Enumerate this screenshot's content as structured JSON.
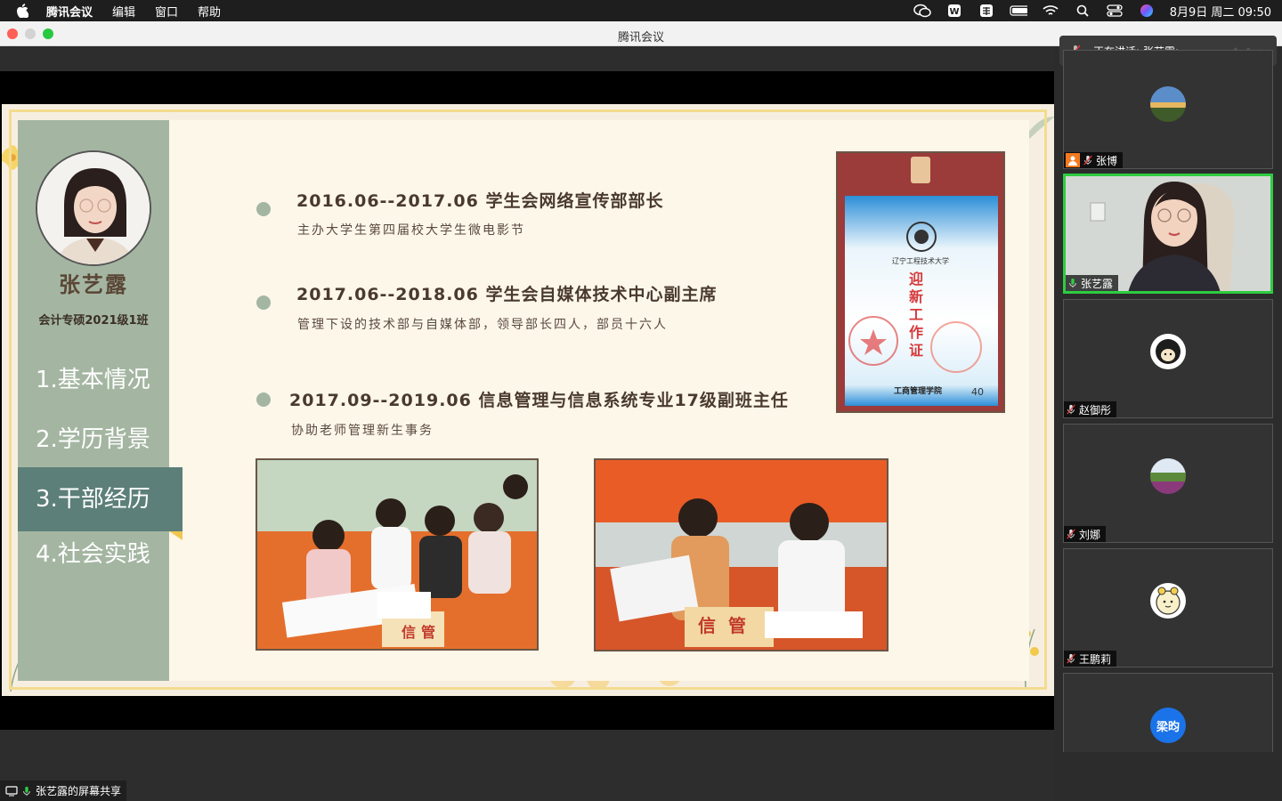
{
  "menubar": {
    "app_name": "腾讯会议",
    "items": [
      "编辑",
      "窗口",
      "帮助"
    ],
    "datetime": "8月9日 周二  09:50",
    "tray_icons": [
      "wechat-icon",
      "wps-icon",
      "input-method-icon",
      "battery-icon",
      "wifi-icon",
      "search-icon",
      "control-center-icon",
      "siri-icon"
    ]
  },
  "window": {
    "title": "腾讯会议"
  },
  "slide": {
    "profile": {
      "name": "张艺露",
      "class": "会计专硕2021级1班"
    },
    "nav": [
      {
        "label": "1.基本情况",
        "active": false
      },
      {
        "label": "2.学历背景",
        "active": false
      },
      {
        "label": "3.干部经历",
        "active": true
      },
      {
        "label": "4.社会实践",
        "active": false
      }
    ],
    "entries": [
      {
        "title": "2016.06--2017.06 学生会网络宣传部部长",
        "desc": "主办大学生第四届校大学生微电影节"
      },
      {
        "title": "2017.06--2018.06 学生会自媒体技术中心副主席",
        "desc": "管理下设的技术部与自媒体部，领导部长四人，部员十六人"
      },
      {
        "title": "2017.09--2019.06 信息管理与信息系统专业17级副班主任",
        "desc": "协助老师管理新生事务"
      }
    ],
    "badge": {
      "university": "辽宁工程技术大学",
      "vertical_text": "迎新工作证",
      "dept": "工商管理学院",
      "number": "40"
    },
    "photo_signs": [
      "信管",
      "信管"
    ]
  },
  "meeting": {
    "speaking_prefix": "正在讲话:",
    "speaking_name": "张艺露;",
    "participants": [
      {
        "name": "张博",
        "active": false,
        "host": true
      },
      {
        "name": "张艺露",
        "active": true,
        "host": false
      },
      {
        "name": "赵御彤",
        "active": false,
        "host": false
      },
      {
        "name": "刘娜",
        "active": false,
        "host": false
      },
      {
        "name": "王鹏莉",
        "active": false,
        "host": false
      },
      {
        "name": "梁昀",
        "active": false,
        "host": false,
        "avatar_text": "梁昀"
      }
    ],
    "share_label": "张艺露的屏幕共享"
  },
  "colors": {
    "sidebar": "#a4b6a2",
    "nav_active": "#5c7f79",
    "active_tile_border": "#2ecc40",
    "avatar_blue": "#1a73e8"
  }
}
